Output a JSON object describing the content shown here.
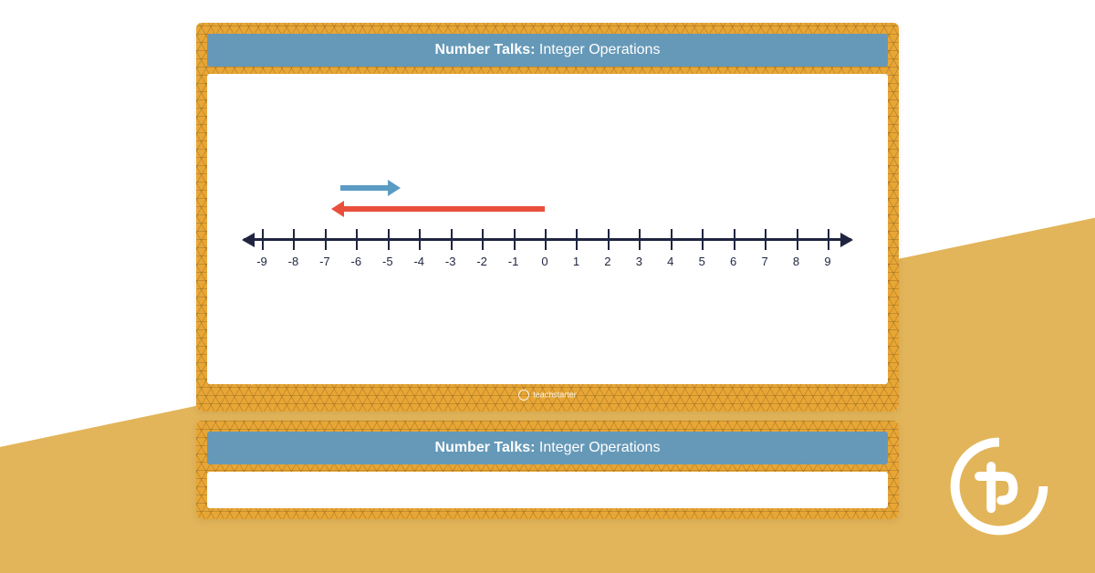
{
  "card": {
    "title_bold": "Number Talks:",
    "title_rest": " Integer Operations",
    "brand": "teachstarter"
  },
  "numberline": {
    "min": -9,
    "max": 9,
    "labels": [
      "-9",
      "-8",
      "-7",
      "-6",
      "-5",
      "-4",
      "-3",
      "-2",
      "-1",
      "0",
      "1",
      "2",
      "3",
      "4",
      "5",
      "6",
      "7",
      "8",
      "9"
    ]
  },
  "chart_data": {
    "type": "numberline-diagram",
    "axis_range": [
      -9,
      9
    ],
    "tick_interval": 1,
    "arrows": [
      {
        "color": "red",
        "from": 0,
        "to": -7,
        "direction": "left",
        "layer": "lower"
      },
      {
        "color": "blue",
        "from": -7,
        "to": -5,
        "direction": "right",
        "layer": "upper"
      }
    ],
    "title": "Number Talks: Integer Operations"
  }
}
